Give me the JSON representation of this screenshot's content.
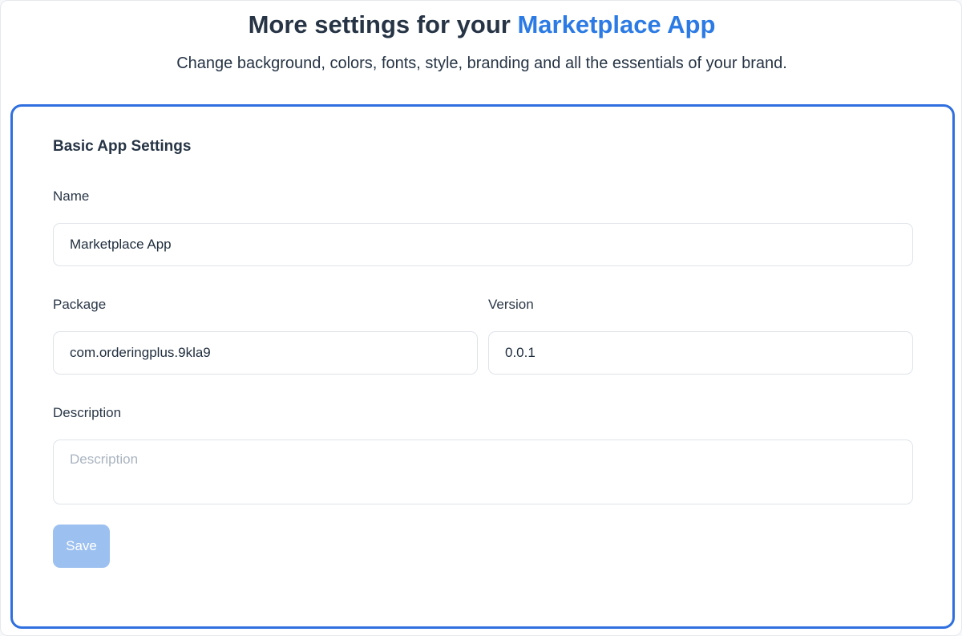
{
  "header": {
    "title_prefix": "More settings for your ",
    "title_accent": "Marketplace App",
    "subtitle": "Change background, colors, fonts, style, branding and all the essentials of your brand."
  },
  "form": {
    "section_title": "Basic App Settings",
    "name": {
      "label": "Name",
      "value": "Marketplace App"
    },
    "package": {
      "label": "Package",
      "value": "com.orderingplus.9kla9"
    },
    "version": {
      "label": "Version",
      "value": "0.0.1"
    },
    "description": {
      "label": "Description",
      "value": "",
      "placeholder": "Description"
    },
    "save_label": "Save"
  },
  "colors": {
    "accent": "#2c7be5",
    "card_border": "#2f6fdf",
    "save_button_disabled": "#9cc0f0"
  }
}
